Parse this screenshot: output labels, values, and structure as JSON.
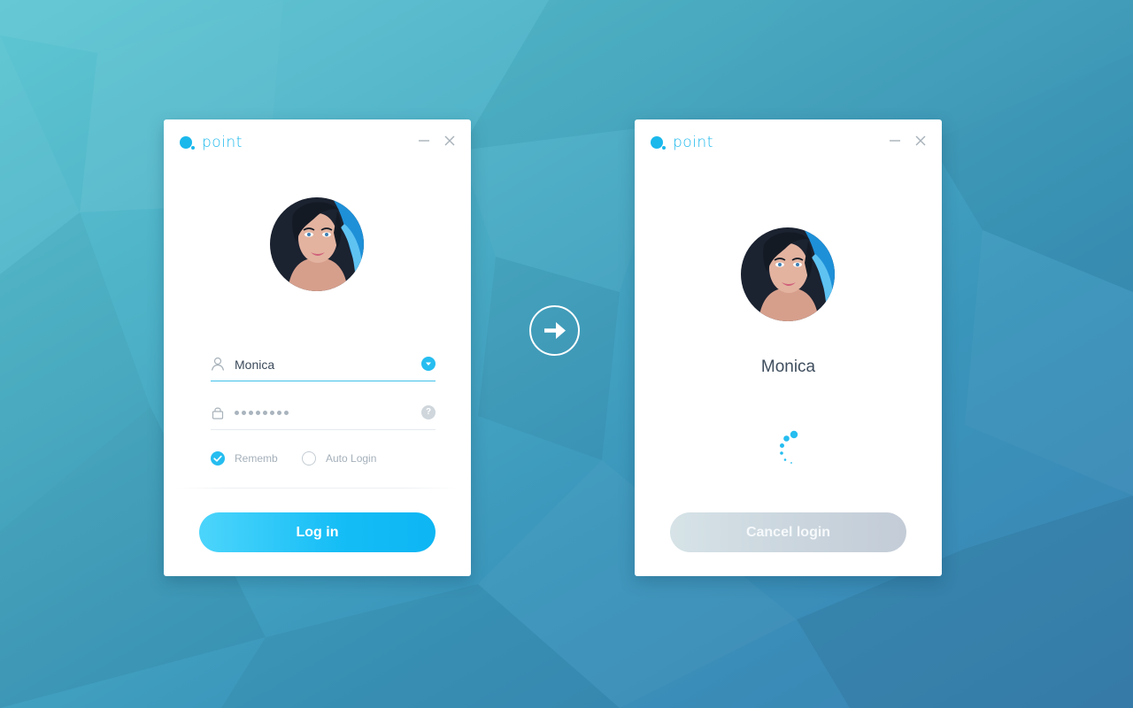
{
  "colors": {
    "accent": "#1bb8ec",
    "button_gradient_start": "#4cd5fb",
    "button_gradient_end": "#0db6f3",
    "cancel_button": "#cbd6de",
    "background_top": "#5ec6d2",
    "background_bottom": "#3a82b3"
  },
  "login_window": {
    "logo": "point",
    "minimize_icon": "minimize-icon",
    "close_icon": "close-icon",
    "avatar": "user-avatar",
    "username": {
      "icon": "user-icon",
      "value": "Monica",
      "dropdown_icon": "chevron-down-icon"
    },
    "password": {
      "icon": "lock-icon",
      "masked_length": 8,
      "help_icon": "help-icon",
      "help_glyph": "?"
    },
    "remember": {
      "label": "Rememb",
      "checked": true
    },
    "auto_login": {
      "label": "Auto Login",
      "checked": false
    },
    "login_button": "Log in"
  },
  "transition": {
    "icon": "arrow-right-icon"
  },
  "loading_window": {
    "logo": "point",
    "minimize_icon": "minimize-icon",
    "close_icon": "close-icon",
    "avatar": "user-avatar",
    "user_name": "Monica",
    "spinner": "loading-spinner-icon",
    "cancel_button": "Cancel login"
  }
}
